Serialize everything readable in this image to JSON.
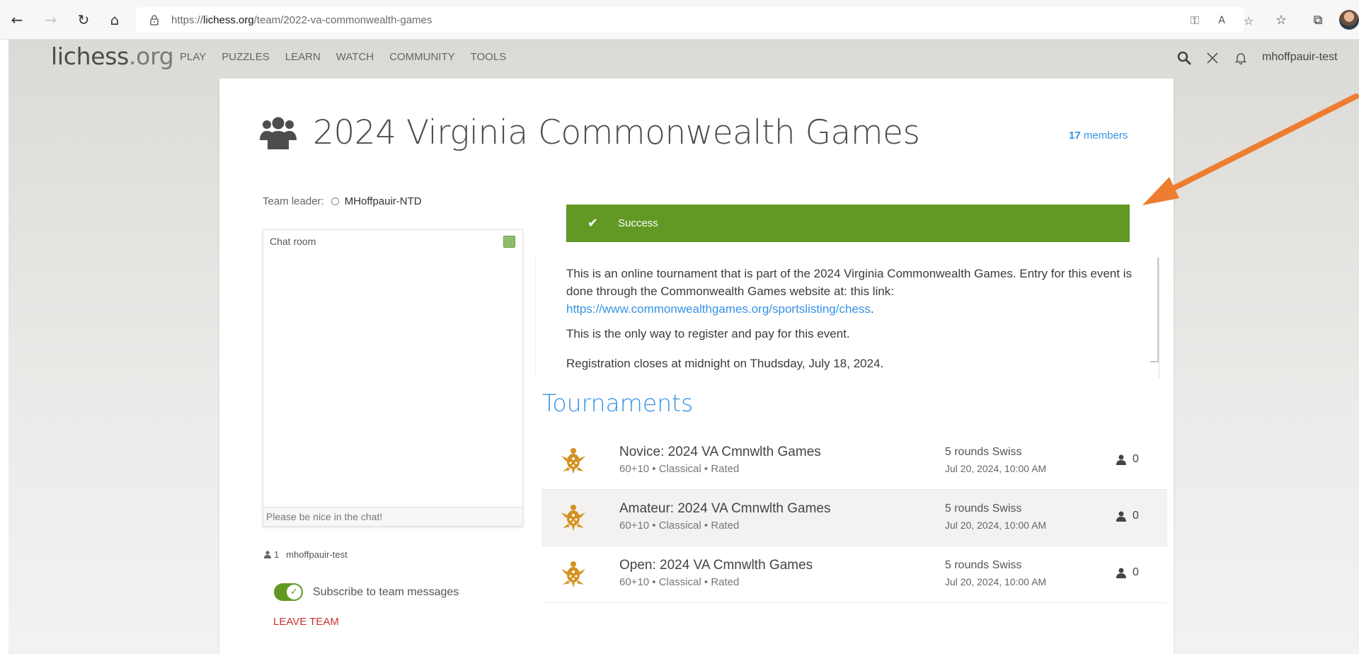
{
  "browser": {
    "url_prefix": "https://",
    "url_domain": "lichess.org",
    "url_path": "/team/2022-va-commonwealth-games"
  },
  "site": {
    "logo_main": "lichess",
    "logo_tld": ".org",
    "nav": [
      "PLAY",
      "PUZZLES",
      "LEARN",
      "WATCH",
      "COMMUNITY",
      "TOOLS"
    ],
    "username": "mhoffpauir-test"
  },
  "team": {
    "title": "2024 Virginia Commonwealth Games",
    "members_count": "17",
    "members_label": "members",
    "leader_label": "Team leader:",
    "leader_name": "MHoffpauir-NTD"
  },
  "chat": {
    "title": "Chat room",
    "placeholder": "Please be nice in the chat!"
  },
  "online": {
    "count": "1",
    "user": "mhoffpauir-test"
  },
  "subscribe_label": "Subscribe to team messages",
  "leave_label": "LEAVE TEAM",
  "flash": {
    "text": "Success",
    "color": "#629924"
  },
  "description": {
    "p1_text": "This is an online tournament that is part of the 2024 Virginia Commonwealth Games. Entry for this event is done through the Commonwealth Games website at: this link:",
    "p1_link": "https://www.commonwealthgames.org/sportslisting/chess",
    "p1_end": ".",
    "p2": "This is the only way to register and pay for this event.",
    "p3": "Registration closes at midnight on Thudsday, July 18, 2024."
  },
  "tournaments": {
    "heading": "Tournaments",
    "rows": [
      {
        "name": "Novice: 2024 VA Cmnwlth Games",
        "meta": "60+10 • Classical • Rated",
        "format": "5 rounds Swiss",
        "date": "Jul 20, 2024, 10:00 AM",
        "players": "0"
      },
      {
        "name": "Amateur: 2024 VA Cmnwlth Games",
        "meta": "60+10 • Classical • Rated",
        "format": "5 rounds Swiss",
        "date": "Jul 20, 2024, 10:00 AM",
        "players": "0"
      },
      {
        "name": "Open: 2024 VA Cmnwlth Games",
        "meta": "60+10 • Classical • Rated",
        "format": "5 rounds Swiss",
        "date": "Jul 20, 2024, 10:00 AM",
        "players": "0"
      }
    ]
  },
  "colors": {
    "accent_blue": "#3692e7",
    "success_green": "#629924",
    "turtle_orange": "#d59120",
    "annotation_arrow": "#ed7d31",
    "leave_red": "#cc3333"
  }
}
